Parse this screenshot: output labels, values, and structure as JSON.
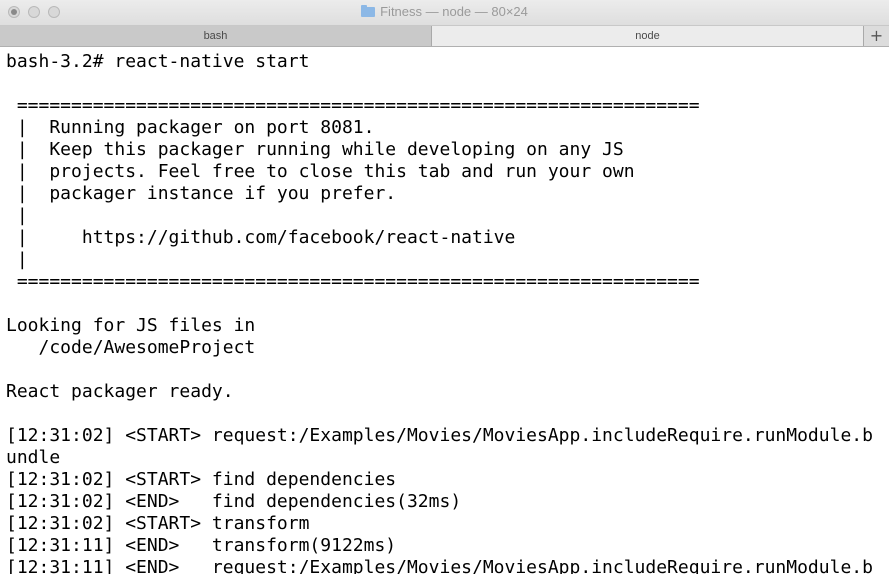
{
  "window": {
    "title": "Fitness — node — 80×24"
  },
  "tabs": [
    {
      "label": "bash",
      "active": false
    },
    {
      "label": "node",
      "active": true
    }
  ],
  "new_tab_label": "+",
  "terminal": {
    "lines": [
      "bash-3.2# react-native start",
      "",
      " ===============================================================",
      " |  Running packager on port 8081.",
      " |  Keep this packager running while developing on any JS",
      " |  projects. Feel free to close this tab and run your own",
      " |  packager instance if you prefer.",
      " |",
      " |     https://github.com/facebook/react-native",
      " |",
      " ===============================================================",
      "",
      "Looking for JS files in",
      "   /code/AwesomeProject",
      "",
      "React packager ready.",
      "",
      "[12:31:02] <START> request:/Examples/Movies/MoviesApp.includeRequire.runModule.b",
      "undle",
      "[12:31:02] <START> find dependencies",
      "[12:31:02] <END>   find dependencies(32ms)",
      "[12:31:02] <START> transform",
      "[12:31:11] <END>   transform(9122ms)",
      "[12:31:11] <END>   request:/Examples/Movies/MoviesApp.includeRequire.runModule.b"
    ]
  },
  "colors": {
    "titlebar": "#e4e4e4",
    "terminal_background": "#ffffff",
    "terminal_text": "#000000",
    "folder_icon": "#8cb8e6"
  },
  "icons": {
    "folder": "folder-icon",
    "close": "close-icon",
    "minimize": "minimize-icon",
    "maximize": "maximize-icon",
    "new_tab": "plus-icon"
  }
}
